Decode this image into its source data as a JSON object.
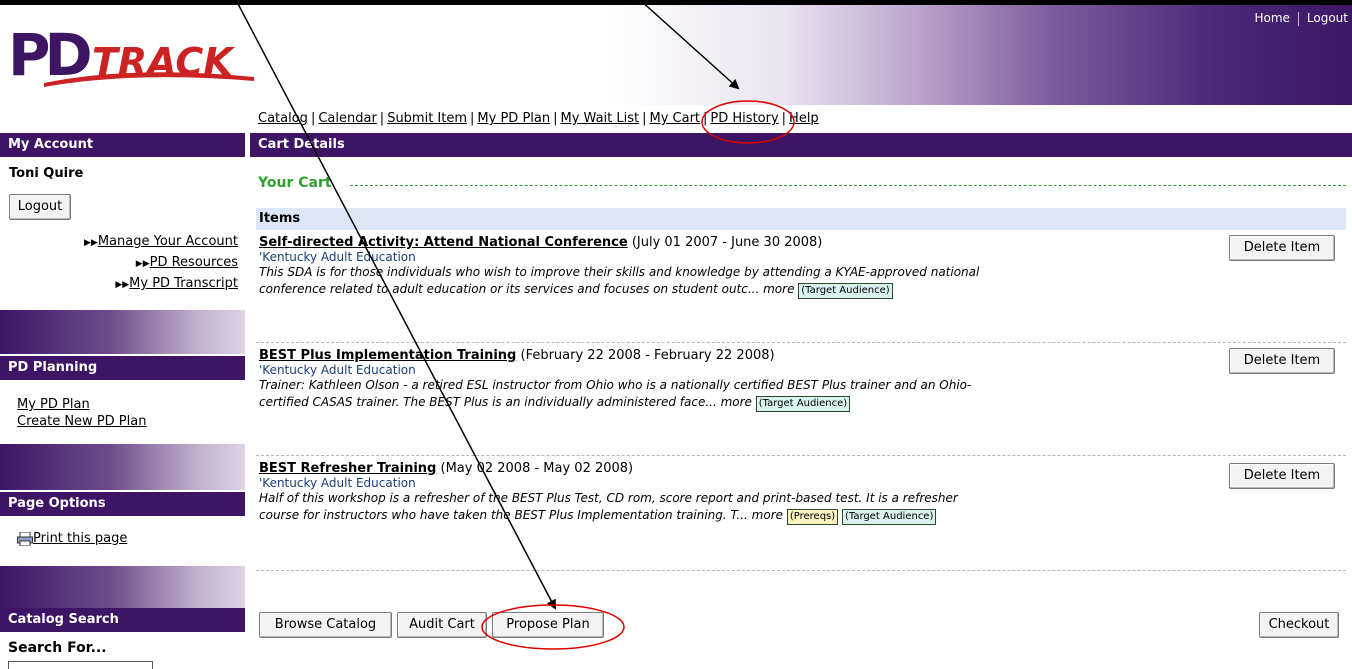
{
  "header": {
    "logo_text_pd": "PD",
    "logo_text_track": "TRACK",
    "home_link": "Home",
    "logout_link": "Logout"
  },
  "mainnav": {
    "items": [
      "Catalog",
      "Calendar",
      "Submit Item",
      "My PD Plan",
      "My Wait List",
      "My Cart",
      "PD History",
      "Help"
    ]
  },
  "sidebar": {
    "my_account": {
      "heading": "My Account",
      "user_name": "Toni Quire",
      "logout_button": "Logout",
      "links": [
        "Manage Your Account",
        "PD Resources",
        "My PD Transcript"
      ]
    },
    "pd_planning": {
      "heading": "PD Planning",
      "links": [
        "My PD Plan",
        "Create New PD Plan"
      ]
    },
    "page_options": {
      "heading": "Page Options",
      "print_link": "Print this page"
    },
    "catalog_search": {
      "heading": "Catalog Search",
      "search_label": "Search For..."
    }
  },
  "content": {
    "heading": "Cart Details",
    "section_title": "Your Cart",
    "items_header": "Items",
    "delete_label": "Delete Item",
    "items": [
      {
        "title": "Self-directed Activity: Attend National Conference",
        "dates": "(July 01 2007 - June 30 2008)",
        "org": "'Kentucky Adult Education",
        "desc": "This SDA is for those individuals who wish to improve their skills and knowledge by attending a KYAE-approved national conference related to adult education or its services and focuses on student outc... more",
        "tags": [
          "(Target Audience)"
        ]
      },
      {
        "title": "BEST Plus Implementation Training",
        "dates": "(February 22 2008 - February 22 2008)",
        "org": "'Kentucky Adult Education",
        "desc": "Trainer: Kathleen Olson - a retired ESL instructor from Ohio who is a nationally certified BEST Plus trainer and an Ohio-certified CASAS trainer. The BEST Plus is an individually administered face... more",
        "tags": [
          "(Target Audience)"
        ]
      },
      {
        "title": "BEST Refresher Training",
        "dates": "(May 02 2008 - May 02 2008)",
        "org": "'Kentucky Adult Education",
        "desc": "Half of this workshop is a refresher of the BEST Plus Test, CD rom, score report and print-based test. It is a refresher course for instructors who have taken the BEST Plus Implementation training. T... more",
        "tags": [
          "(Prereqs)",
          "(Target Audience)"
        ]
      }
    ],
    "buttons": {
      "browse": "Browse Catalog",
      "audit": "Audit Cart",
      "propose": "Propose Plan",
      "checkout": "Checkout"
    }
  },
  "colors": {
    "brand_purple": "#3e1564",
    "logo_red": "#cc2222",
    "section_green": "#2ea02e",
    "annotation_red": "#dd0000"
  }
}
